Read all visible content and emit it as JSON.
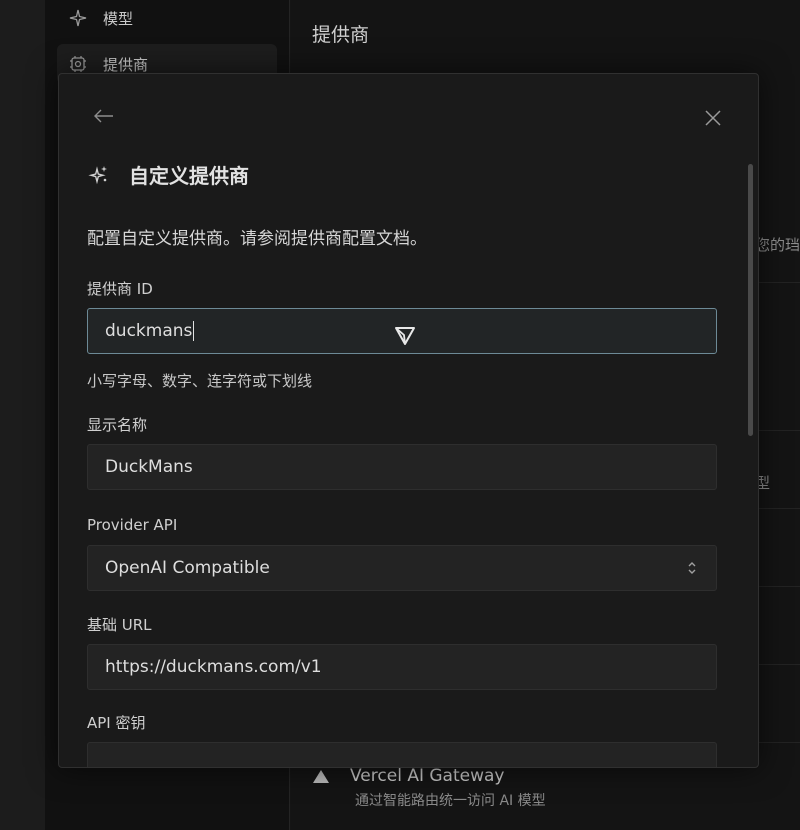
{
  "sidebar": {
    "items": [
      {
        "label": "模型",
        "icon": "sparkle-icon"
      },
      {
        "label": "提供商",
        "icon": "provider-chip-icon"
      }
    ]
  },
  "main": {
    "title": "提供商",
    "edge_text_1": "您的珰",
    "edge_text_2": "型",
    "vercel": {
      "name": "Vercel AI Gateway",
      "description": "通过智能路由统一访问 AI 模型"
    }
  },
  "modal": {
    "title": "自定义提供商",
    "description": "配置自定义提供商。请参阅提供商配置文档。",
    "fields": {
      "provider_id": {
        "label": "提供商 ID",
        "value": "duckmans",
        "help": "小写字母、数字、连字符或下划线"
      },
      "display_name": {
        "label": "显示名称",
        "value": "DuckMans"
      },
      "provider_api": {
        "label": "Provider API",
        "value": "OpenAI Compatible"
      },
      "base_url": {
        "label": "基础 URL",
        "value": "https://duckmans.com/v1"
      },
      "api_key": {
        "label": "API 密钥",
        "value": "•••••••••••"
      }
    }
  },
  "colors": {
    "background": "#151515",
    "modal": "#1a1a1a",
    "input": "#232323",
    "focus_border": "#6d8a96"
  }
}
